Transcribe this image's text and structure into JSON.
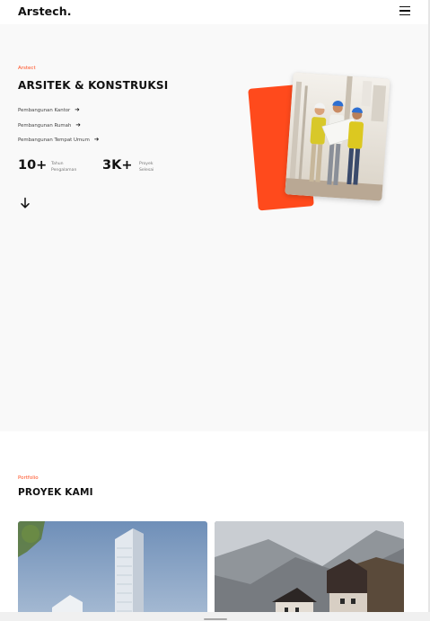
{
  "header": {
    "brand": "Arstech.",
    "menu_icon": "hamburger-menu-icon"
  },
  "hero": {
    "eyebrow": "Arstect",
    "title": "ARSITEK & KONSTRUKSI",
    "services": [
      {
        "label": "Pembangunan Kantor",
        "icon": "arrow-right-icon"
      },
      {
        "label": "Pembangunan Rumah",
        "icon": "arrow-right-icon"
      },
      {
        "label": "Pembangunan Tempat Umum",
        "icon": "arrow-right-icon"
      }
    ],
    "stats": [
      {
        "value": "10+",
        "label_line1": "Tahun",
        "label_line2": "Pengalaman"
      },
      {
        "value": "3K+",
        "label_line1": "Proyek",
        "label_line2": "Selesai"
      }
    ],
    "scroll_icon": "arrow-down-icon",
    "accent_color": "#ff4a1c"
  },
  "portfolio": {
    "eyebrow": "Portfolio",
    "title": "PROYEK KAMI"
  },
  "colors": {
    "accent": "#ff4c1f",
    "hero_background": "#f9f9f9",
    "text": "#111111"
  }
}
